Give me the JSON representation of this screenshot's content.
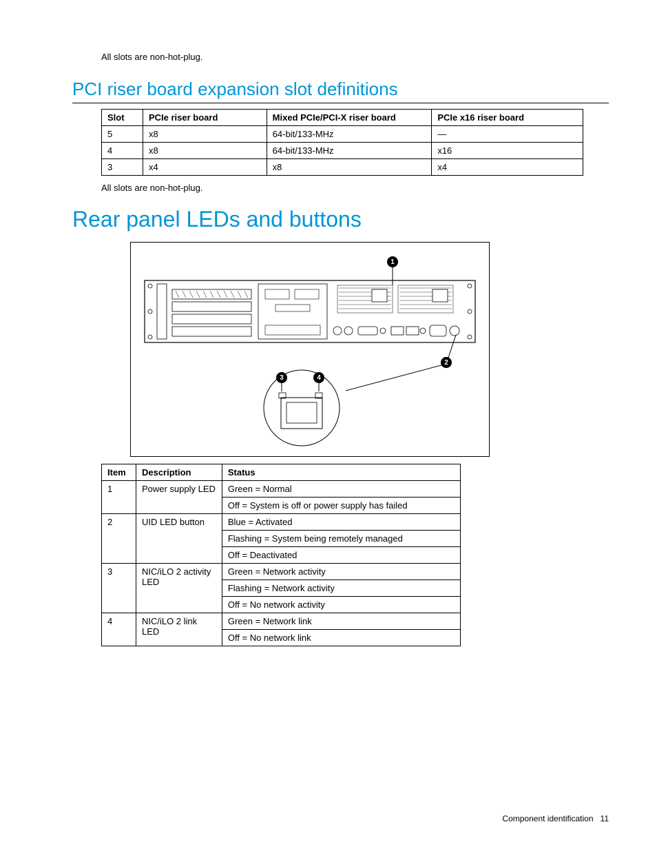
{
  "intro_note": "All slots are non-hot-plug.",
  "section1": {
    "heading": "PCI riser board expansion slot definitions",
    "table": {
      "headers": [
        "Slot",
        "PCIe riser board",
        "Mixed PCIe/PCI-X riser board",
        "PCIe x16 riser board"
      ],
      "rows": [
        [
          "5",
          "x8",
          "64-bit/133-MHz",
          "—"
        ],
        [
          "4",
          "x8",
          "64-bit/133-MHz",
          "x16"
        ],
        [
          "3",
          "x4",
          "x8",
          "x4"
        ]
      ]
    },
    "note": "All slots are non-hot-plug."
  },
  "section2": {
    "heading": "Rear panel LEDs and buttons",
    "callouts": {
      "c1": "1",
      "c2": "2",
      "c3": "3",
      "c4": "4"
    },
    "table": {
      "headers": [
        "Item",
        "Description",
        "Status"
      ],
      "rows": [
        {
          "item": "1",
          "desc": "Power supply LED",
          "status": [
            "Green = Normal",
            "Off = System is off or power supply has failed"
          ]
        },
        {
          "item": "2",
          "desc": "UID LED button",
          "status": [
            "Blue = Activated",
            "Flashing = System being remotely managed",
            "Off = Deactivated"
          ]
        },
        {
          "item": "3",
          "desc": "NIC/iLO 2 activity LED",
          "status": [
            "Green = Network activity",
            "Flashing = Network activity",
            "Off = No network activity"
          ]
        },
        {
          "item": "4",
          "desc": "NIC/iLO 2 link LED",
          "status": [
            "Green = Network link",
            "Off = No network link"
          ]
        }
      ]
    }
  },
  "footer": {
    "label": "Component identification",
    "page": "11"
  }
}
